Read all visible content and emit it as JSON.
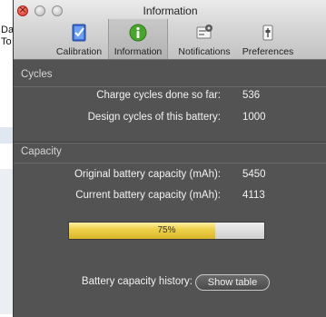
{
  "background": {
    "fragments": [
      "Da",
      "To"
    ]
  },
  "window": {
    "title": "Information"
  },
  "toolbar": {
    "tabs": [
      {
        "label": "Calibration",
        "icon": "calibration-icon"
      },
      {
        "label": "Information",
        "icon": "info-icon",
        "active": true
      },
      {
        "label": "Notifications",
        "icon": "notifications-icon"
      },
      {
        "label": "Preferences",
        "icon": "preferences-icon"
      }
    ]
  },
  "cycles": {
    "header": "Cycles",
    "charge_done_label": "Charge cycles done so far:",
    "charge_done_value": "536",
    "design_label": "Design cycles of this battery:",
    "design_value": "1000"
  },
  "capacity": {
    "header": "Capacity",
    "original_label": "Original battery capacity (mAh):",
    "original_value": "5450",
    "current_label": "Current battery capacity (mAh):",
    "current_value": "4113",
    "percent_text": "75%",
    "percent_value": 75
  },
  "history": {
    "label": "Battery capacity history:",
    "button": "Show table"
  },
  "colors": {
    "panel": "#535353",
    "bar_fill": "#efd24c",
    "accent_info": "#4aa52f"
  }
}
